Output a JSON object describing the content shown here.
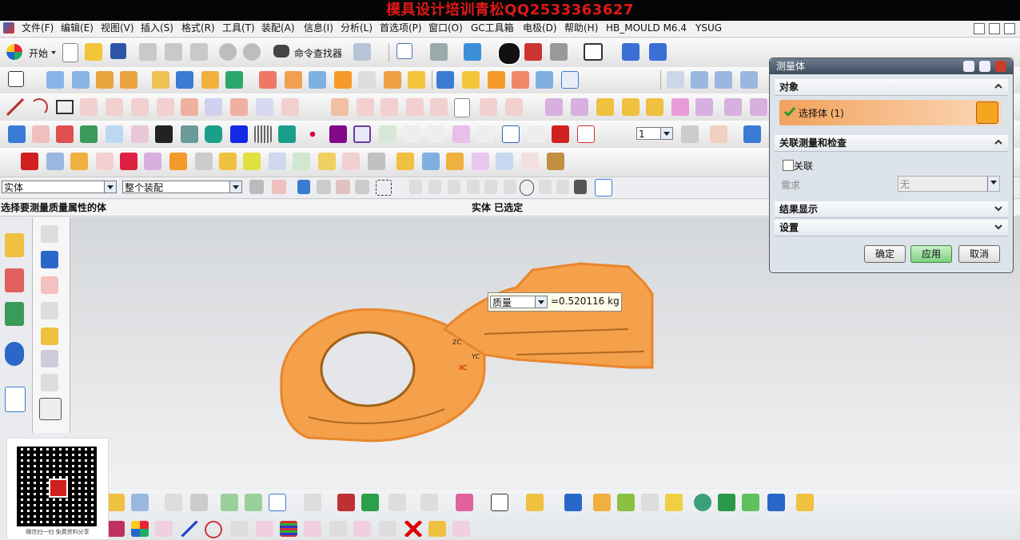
{
  "banner": {
    "text": "模具设计培训青松QQ2533363627"
  },
  "menu": {
    "items": [
      "文件(F)",
      "编辑(E)",
      "视图(V)",
      "插入(S)",
      "格式(R)",
      "工具(T)",
      "装配(A)",
      "信息(I)",
      "分析(L)",
      "首选项(P)",
      "窗口(O)",
      "GC工具箱",
      "电极(D)",
      "帮助(H)",
      "HB_MOULD M6.4",
      "YSUG"
    ]
  },
  "toolbar": {
    "start_label": "开始",
    "command_finder_label": "命令查找器"
  },
  "selection_bar": {
    "filter_type": "实体",
    "scope": "整个装配"
  },
  "status": {
    "prompt": "选择要测量质量属性的体",
    "message": "实体 已选定"
  },
  "view_combo": {
    "value": "1"
  },
  "measurement": {
    "type": "质量",
    "value": "=0.520116 kg"
  },
  "axes": {
    "zc": "ZC",
    "yc": "YC",
    "xc": "XC"
  },
  "dialog": {
    "title": "测量体",
    "section_object": "对象",
    "select_body_label": "选择体 (1)",
    "section_associative": "关联测量和检查",
    "associative_checkbox_label": "关联",
    "requirement_label": "需求",
    "requirement_value": "无",
    "section_results": "结果显示",
    "section_settings": "设置",
    "ok_button": "确定",
    "apply_button": "应用",
    "cancel_button": "取消",
    "accent_color": "#f2a25c"
  },
  "qr": {
    "caption": "微信扫一扫  免费资料分享"
  },
  "model": {
    "color": "#f5a04a"
  }
}
